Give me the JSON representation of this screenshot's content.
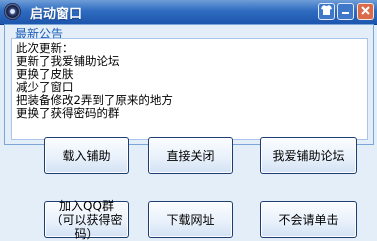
{
  "window": {
    "title": "启动窗口"
  },
  "titlebar_icons": {
    "skin": "shirt-icon",
    "minimize": "minimize-icon",
    "close": "close-icon"
  },
  "notice": {
    "caption": "最新公告",
    "lines": [
      "此次更新：",
      "更新了我爱铺助论坛",
      "更换了皮肤",
      "减少了窗口",
      "把装备修改2弄到了原来的地方",
      "更换了获得密码的群"
    ]
  },
  "buttons": {
    "load": "载入铺助",
    "close_direct": "直接关闭",
    "forum": "我爱铺助论坛",
    "join_qq": "加入QQ群（可以获得密码）",
    "download": "下载网址",
    "help": "不会请单击"
  },
  "colors": {
    "accent": "#2f6cc0",
    "caption": "#1d5fb8",
    "background": "#e4eef8"
  }
}
